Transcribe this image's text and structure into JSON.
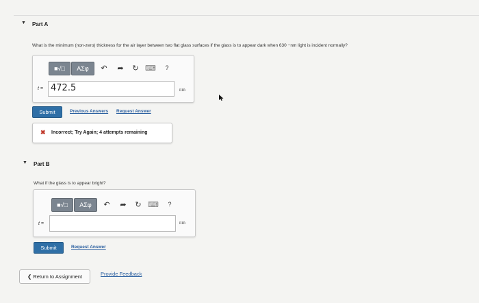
{
  "colors": {
    "page_bg": "#f4f4f2",
    "submit_bg": "#2f6fa6",
    "link": "#2a5fa0",
    "error_x": "#c0392b",
    "toolbar_btn": "#7b8590"
  },
  "part_a": {
    "header": "Part A",
    "question": "What is the minimum (non-zero) thickness for the air layer between two flat glass surfaces if the glass is to appear dark when 630 −nm light is incident normally?",
    "toolbar": {
      "template_label": "■√□",
      "symbols_label": "AΣφ",
      "undo_icon": "↶",
      "redo_icon": "➦",
      "reset_icon": "↻",
      "keyboard_icon": "⌨",
      "help_label": "?"
    },
    "variable": "t =",
    "answer_value": "472.5",
    "unit": "nm",
    "submit_label": "Submit",
    "previous_answers_label": "Previous Answers",
    "request_answer_label": "Request Answer",
    "feedback": {
      "icon": "✖",
      "text": "Incorrect; Try Again; 4 attempts remaining"
    }
  },
  "part_b": {
    "header": "Part B",
    "question": "What if the glass is to appear bright?",
    "toolbar": {
      "template_label": "■√□",
      "symbols_label": "AΣφ",
      "undo_icon": "↶",
      "redo_icon": "➦",
      "reset_icon": "↻",
      "keyboard_icon": "⌨",
      "help_label": "?"
    },
    "variable": "t =",
    "answer_value": "",
    "unit": "nm",
    "submit_label": "Submit",
    "request_answer_label": "Request Answer"
  },
  "footer": {
    "return_label": "❮ Return to Assignment",
    "feedback_label": "Provide Feedback"
  }
}
